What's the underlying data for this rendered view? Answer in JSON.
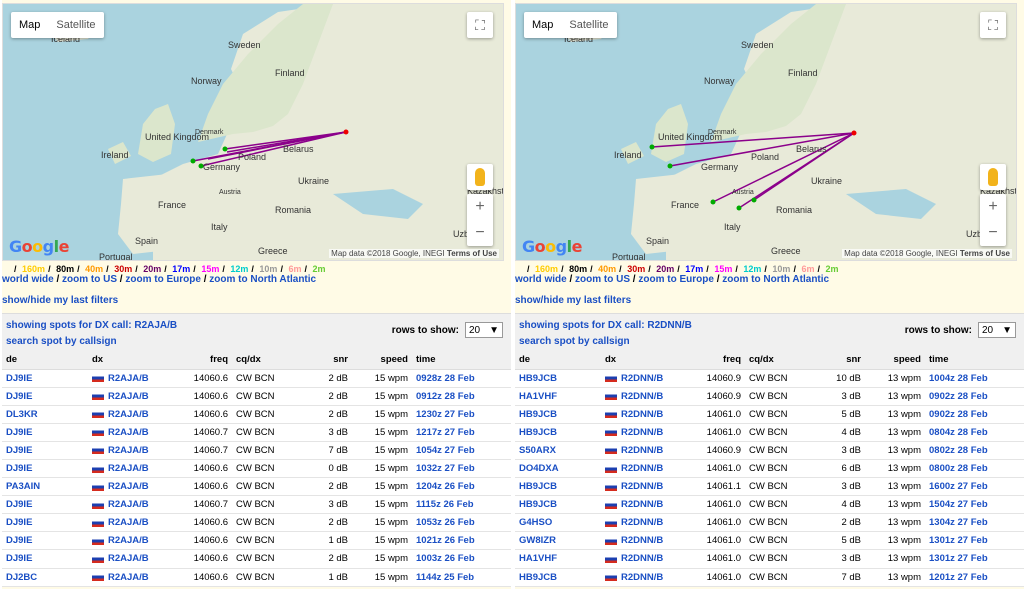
{
  "map": {
    "tabs": [
      "Map",
      "Satellite"
    ],
    "active_tab": "Map",
    "attribution": "Map data ©2018 Google, INEGI",
    "terms": "Terms of Use",
    "logo": "Google",
    "labels": {
      "iceland": "Iceland",
      "sweden": "Sweden",
      "norway": "Norway",
      "finland": "Finland",
      "denmark": "Denmark",
      "uk": "United Kingdom",
      "ireland": "Ireland",
      "germany": "Germany",
      "poland": "Poland",
      "belarus": "Belarus",
      "ukraine": "Ukraine",
      "austria": "Austria",
      "france": "France",
      "romania": "Romania",
      "italy": "Italy",
      "spain": "Spain",
      "portugal": "Portugal",
      "greece": "Greece",
      "kazakhstan": "Kazakhst",
      "uzbek": "Uzbe"
    }
  },
  "bands": [
    {
      "label": "160m",
      "color": "#ffcc00"
    },
    {
      "label": "80m",
      "color": "#000000"
    },
    {
      "label": "40m",
      "color": "#ff9900"
    },
    {
      "label": "30m",
      "color": "#cc0000"
    },
    {
      "label": "20m",
      "color": "#660066"
    },
    {
      "label": "17m",
      "color": "#0000ff"
    },
    {
      "label": "15m",
      "color": "#ff00ff"
    },
    {
      "label": "12m",
      "color": "#00cccc"
    },
    {
      "label": "10m",
      "color": "#999999"
    },
    {
      "label": "6m",
      "color": "#ff9999"
    },
    {
      "label": "2m",
      "color": "#66cc33"
    }
  ],
  "zoom_links": [
    "world wide",
    "zoom to US",
    "zoom to Europe",
    "zoom to North Atlantic"
  ],
  "filters_label": "show/hide my last filters",
  "search_label": "search spot by callsign",
  "rows_label": "rows to show:",
  "rows_value": "20",
  "columns": [
    "de",
    "dx",
    "freq",
    "cq/dx",
    "snr",
    "speed",
    "time"
  ],
  "panels": [
    {
      "showing": "showing spots for DX call: R2AJA/B",
      "rows": [
        [
          "DJ9IE",
          "R2AJA/B",
          "14060.6",
          "CW BCN",
          "2 dB",
          "15 wpm",
          "0928z 28 Feb"
        ],
        [
          "DJ9IE",
          "R2AJA/B",
          "14060.6",
          "CW BCN",
          "2 dB",
          "15 wpm",
          "0912z 28 Feb"
        ],
        [
          "DL3KR",
          "R2AJA/B",
          "14060.6",
          "CW BCN",
          "2 dB",
          "15 wpm",
          "1230z 27 Feb"
        ],
        [
          "DJ9IE",
          "R2AJA/B",
          "14060.7",
          "CW BCN",
          "3 dB",
          "15 wpm",
          "1217z 27 Feb"
        ],
        [
          "DJ9IE",
          "R2AJA/B",
          "14060.7",
          "CW BCN",
          "7 dB",
          "15 wpm",
          "1054z 27 Feb"
        ],
        [
          "DJ9IE",
          "R2AJA/B",
          "14060.6",
          "CW BCN",
          "0 dB",
          "15 wpm",
          "1032z 27 Feb"
        ],
        [
          "PA3AIN",
          "R2AJA/B",
          "14060.6",
          "CW BCN",
          "2 dB",
          "15 wpm",
          "1204z 26 Feb"
        ],
        [
          "DJ9IE",
          "R2AJA/B",
          "14060.7",
          "CW BCN",
          "3 dB",
          "15 wpm",
          "1115z 26 Feb"
        ],
        [
          "DJ9IE",
          "R2AJA/B",
          "14060.6",
          "CW BCN",
          "2 dB",
          "15 wpm",
          "1053z 26 Feb"
        ],
        [
          "DJ9IE",
          "R2AJA/B",
          "14060.6",
          "CW BCN",
          "1 dB",
          "15 wpm",
          "1021z 26 Feb"
        ],
        [
          "DJ9IE",
          "R2AJA/B",
          "14060.6",
          "CW BCN",
          "2 dB",
          "15 wpm",
          "1003z 26 Feb"
        ],
        [
          "DJ2BC",
          "R2AJA/B",
          "14060.6",
          "CW BCN",
          "1 dB",
          "15 wpm",
          "1144z 25 Feb"
        ]
      ]
    },
    {
      "showing": "showing spots for DX call: R2DNN/B",
      "rows": [
        [
          "HB9JCB",
          "R2DNN/B",
          "14060.9",
          "CW BCN",
          "10 dB",
          "13 wpm",
          "1004z 28 Feb"
        ],
        [
          "HA1VHF",
          "R2DNN/B",
          "14060.9",
          "CW BCN",
          "3 dB",
          "13 wpm",
          "0902z 28 Feb"
        ],
        [
          "HB9JCB",
          "R2DNN/B",
          "14061.0",
          "CW BCN",
          "5 dB",
          "13 wpm",
          "0902z 28 Feb"
        ],
        [
          "HB9JCB",
          "R2DNN/B",
          "14061.0",
          "CW BCN",
          "4 dB",
          "13 wpm",
          "0804z 28 Feb"
        ],
        [
          "S50ARX",
          "R2DNN/B",
          "14060.9",
          "CW BCN",
          "3 dB",
          "13 wpm",
          "0802z 28 Feb"
        ],
        [
          "DO4DXA",
          "R2DNN/B",
          "14061.0",
          "CW BCN",
          "6 dB",
          "13 wpm",
          "0800z 28 Feb"
        ],
        [
          "HB9JCB",
          "R2DNN/B",
          "14061.1",
          "CW BCN",
          "3 dB",
          "13 wpm",
          "1600z 27 Feb"
        ],
        [
          "HB9JCB",
          "R2DNN/B",
          "14061.0",
          "CW BCN",
          "4 dB",
          "13 wpm",
          "1504z 27 Feb"
        ],
        [
          "G4HSO",
          "R2DNN/B",
          "14061.0",
          "CW BCN",
          "2 dB",
          "13 wpm",
          "1304z 27 Feb"
        ],
        [
          "GW8IZR",
          "R2DNN/B",
          "14061.0",
          "CW BCN",
          "5 dB",
          "13 wpm",
          "1301z 27 Feb"
        ],
        [
          "HA1VHF",
          "R2DNN/B",
          "14061.0",
          "CW BCN",
          "3 dB",
          "13 wpm",
          "1301z 27 Feb"
        ],
        [
          "HB9JCB",
          "R2DNN/B",
          "14061.0",
          "CW BCN",
          "7 dB",
          "13 wpm",
          "1201z 27 Feb"
        ]
      ]
    }
  ]
}
